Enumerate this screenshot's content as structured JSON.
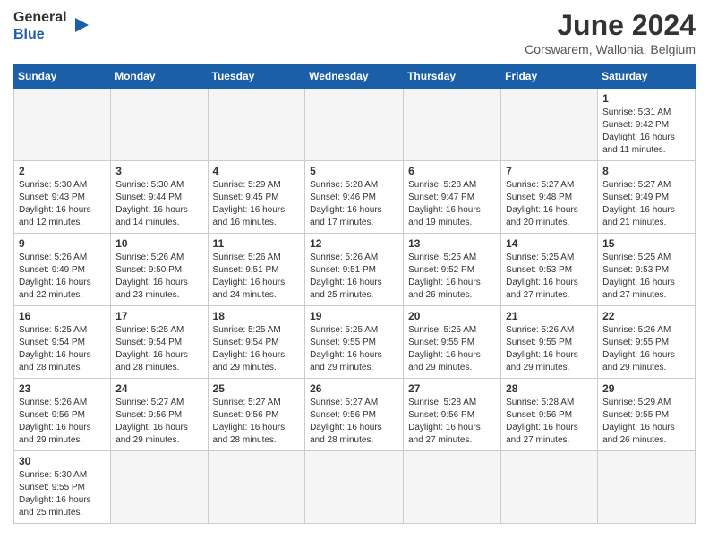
{
  "logo": {
    "text_general": "General",
    "text_blue": "Blue"
  },
  "header": {
    "month": "June 2024",
    "location": "Corswarem, Wallonia, Belgium"
  },
  "weekdays": [
    "Sunday",
    "Monday",
    "Tuesday",
    "Wednesday",
    "Thursday",
    "Friday",
    "Saturday"
  ],
  "weeks": [
    [
      {
        "day": "",
        "info": ""
      },
      {
        "day": "",
        "info": ""
      },
      {
        "day": "",
        "info": ""
      },
      {
        "day": "",
        "info": ""
      },
      {
        "day": "",
        "info": ""
      },
      {
        "day": "",
        "info": ""
      },
      {
        "day": "1",
        "info": "Sunrise: 5:31 AM\nSunset: 9:42 PM\nDaylight: 16 hours and 11 minutes."
      }
    ],
    [
      {
        "day": "2",
        "info": "Sunrise: 5:30 AM\nSunset: 9:43 PM\nDaylight: 16 hours and 12 minutes."
      },
      {
        "day": "3",
        "info": "Sunrise: 5:30 AM\nSunset: 9:44 PM\nDaylight: 16 hours and 14 minutes."
      },
      {
        "day": "4",
        "info": "Sunrise: 5:29 AM\nSunset: 9:45 PM\nDaylight: 16 hours and 16 minutes."
      },
      {
        "day": "5",
        "info": "Sunrise: 5:28 AM\nSunset: 9:46 PM\nDaylight: 16 hours and 17 minutes."
      },
      {
        "day": "6",
        "info": "Sunrise: 5:28 AM\nSunset: 9:47 PM\nDaylight: 16 hours and 19 minutes."
      },
      {
        "day": "7",
        "info": "Sunrise: 5:27 AM\nSunset: 9:48 PM\nDaylight: 16 hours and 20 minutes."
      },
      {
        "day": "8",
        "info": "Sunrise: 5:27 AM\nSunset: 9:49 PM\nDaylight: 16 hours and 21 minutes."
      }
    ],
    [
      {
        "day": "9",
        "info": "Sunrise: 5:26 AM\nSunset: 9:49 PM\nDaylight: 16 hours and 22 minutes."
      },
      {
        "day": "10",
        "info": "Sunrise: 5:26 AM\nSunset: 9:50 PM\nDaylight: 16 hours and 23 minutes."
      },
      {
        "day": "11",
        "info": "Sunrise: 5:26 AM\nSunset: 9:51 PM\nDaylight: 16 hours and 24 minutes."
      },
      {
        "day": "12",
        "info": "Sunrise: 5:26 AM\nSunset: 9:51 PM\nDaylight: 16 hours and 25 minutes."
      },
      {
        "day": "13",
        "info": "Sunrise: 5:25 AM\nSunset: 9:52 PM\nDaylight: 16 hours and 26 minutes."
      },
      {
        "day": "14",
        "info": "Sunrise: 5:25 AM\nSunset: 9:53 PM\nDaylight: 16 hours and 27 minutes."
      },
      {
        "day": "15",
        "info": "Sunrise: 5:25 AM\nSunset: 9:53 PM\nDaylight: 16 hours and 27 minutes."
      }
    ],
    [
      {
        "day": "16",
        "info": "Sunrise: 5:25 AM\nSunset: 9:54 PM\nDaylight: 16 hours and 28 minutes."
      },
      {
        "day": "17",
        "info": "Sunrise: 5:25 AM\nSunset: 9:54 PM\nDaylight: 16 hours and 28 minutes."
      },
      {
        "day": "18",
        "info": "Sunrise: 5:25 AM\nSunset: 9:54 PM\nDaylight: 16 hours and 29 minutes."
      },
      {
        "day": "19",
        "info": "Sunrise: 5:25 AM\nSunset: 9:55 PM\nDaylight: 16 hours and 29 minutes."
      },
      {
        "day": "20",
        "info": "Sunrise: 5:25 AM\nSunset: 9:55 PM\nDaylight: 16 hours and 29 minutes."
      },
      {
        "day": "21",
        "info": "Sunrise: 5:26 AM\nSunset: 9:55 PM\nDaylight: 16 hours and 29 minutes."
      },
      {
        "day": "22",
        "info": "Sunrise: 5:26 AM\nSunset: 9:55 PM\nDaylight: 16 hours and 29 minutes."
      }
    ],
    [
      {
        "day": "23",
        "info": "Sunrise: 5:26 AM\nSunset: 9:56 PM\nDaylight: 16 hours and 29 minutes."
      },
      {
        "day": "24",
        "info": "Sunrise: 5:27 AM\nSunset: 9:56 PM\nDaylight: 16 hours and 29 minutes."
      },
      {
        "day": "25",
        "info": "Sunrise: 5:27 AM\nSunset: 9:56 PM\nDaylight: 16 hours and 28 minutes."
      },
      {
        "day": "26",
        "info": "Sunrise: 5:27 AM\nSunset: 9:56 PM\nDaylight: 16 hours and 28 minutes."
      },
      {
        "day": "27",
        "info": "Sunrise: 5:28 AM\nSunset: 9:56 PM\nDaylight: 16 hours and 27 minutes."
      },
      {
        "day": "28",
        "info": "Sunrise: 5:28 AM\nSunset: 9:56 PM\nDaylight: 16 hours and 27 minutes."
      },
      {
        "day": "29",
        "info": "Sunrise: 5:29 AM\nSunset: 9:55 PM\nDaylight: 16 hours and 26 minutes."
      }
    ],
    [
      {
        "day": "30",
        "info": "Sunrise: 5:30 AM\nSunset: 9:55 PM\nDaylight: 16 hours and 25 minutes."
      },
      {
        "day": "",
        "info": ""
      },
      {
        "day": "",
        "info": ""
      },
      {
        "day": "",
        "info": ""
      },
      {
        "day": "",
        "info": ""
      },
      {
        "day": "",
        "info": ""
      },
      {
        "day": "",
        "info": ""
      }
    ]
  ]
}
